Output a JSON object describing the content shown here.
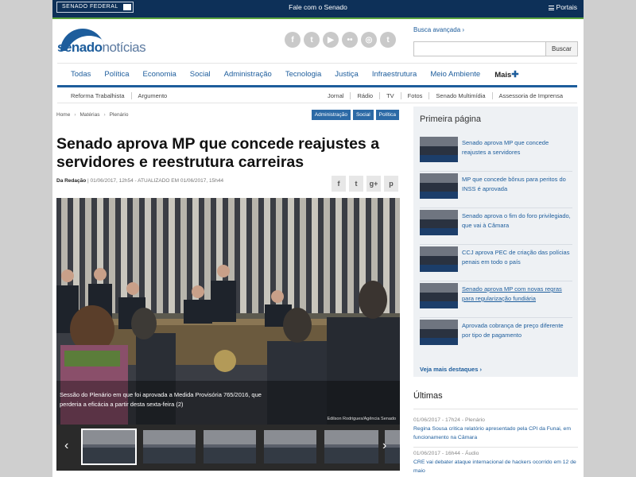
{
  "topbar": {
    "brand": "SENADO FEDERAL",
    "fale": "Fale com o Senado",
    "portais": "Portais"
  },
  "header": {
    "logo_bold": "senado",
    "logo_light": "notícias",
    "social_icons": [
      "facebook-icon",
      "twitter-icon",
      "youtube-icon",
      "flickr-icon",
      "instagram-icon",
      "tumblr-icon"
    ],
    "social_glyphs": [
      "f",
      "t",
      "▶",
      "••",
      "◎",
      "t"
    ],
    "busca_avancada": "Busca avançada ›",
    "search_placeholder": "",
    "search_button": "Buscar"
  },
  "nav": {
    "items": [
      "Todas",
      "Política",
      "Economia",
      "Social",
      "Administração",
      "Tecnologia",
      "Justiça",
      "Infraestrutura",
      "Meio Ambiente"
    ],
    "more": "Mais"
  },
  "subnav": {
    "left": [
      "Reforma Trabalhista",
      "Argumento"
    ],
    "right": [
      "Jornal",
      "Rádio",
      "TV",
      "Fotos",
      "Senado Multimídia",
      "Assessoria de Imprensa"
    ]
  },
  "article": {
    "breadcrumb": [
      "Home",
      "Matérias",
      "Plenário"
    ],
    "tags": [
      "Administração",
      "Social",
      "Política"
    ],
    "title": "Senado aprova MP que concede reajustes a servidores e reestrutura carreiras",
    "author": "Da Redação",
    "dateline": " | 01/06/2017, 12h54 - ATUALIZADO EM 01/06/2017, 15h44",
    "share_icons": [
      "facebook-share-icon",
      "twitter-share-icon",
      "google-plus-share-icon",
      "pinterest-share-icon"
    ],
    "share_glyphs": [
      "f",
      "t",
      "g+",
      "p"
    ],
    "photo_caption": "Sessão do Plenário em que foi aprovada a Medida Provisória 765/2016, que perderia a eficácia a partir desta sexta-feira (2)",
    "photo_credit": "Edilson Rodrigues/Agência Senado"
  },
  "sidebar": {
    "heading": "Primeira página",
    "items": [
      {
        "text": "Senado aprova MP que concede reajustes a servidores",
        "underlined": false
      },
      {
        "text": "MP que concede bônus para peritos do INSS é aprovada",
        "underlined": false
      },
      {
        "text": "Senado aprova o fim do foro privilegiado, que vai à Câmara",
        "underlined": false
      },
      {
        "text": "CCJ aprova PEC de criação das polícias penais em todo o país",
        "underlined": false
      },
      {
        "text": "Senado aprova MP com novas regras para regularização fundiária",
        "underlined": true
      },
      {
        "text": "Aprovada cobrança de preço diferente por tipo de pagamento",
        "underlined": false
      }
    ],
    "more": "Veja mais destaques ›"
  },
  "ultimas": {
    "heading": "Últimas",
    "items": [
      {
        "meta": "01/06/2017 - 17h24 - Plenário",
        "headline": "Regina Sousa critica relatório apresentado pela CPI da Funai, em funcionamento na Câmara"
      },
      {
        "meta": "01/06/2017 - 16h44 - Áudio",
        "headline": "CRE vai debater ataque internacional de hackers ocorrido em 12 de maio"
      }
    ]
  },
  "colors": {
    "brand_blue": "#1d5d9c",
    "topbar": "#0d3058",
    "accent_green": "#5aa33d"
  }
}
